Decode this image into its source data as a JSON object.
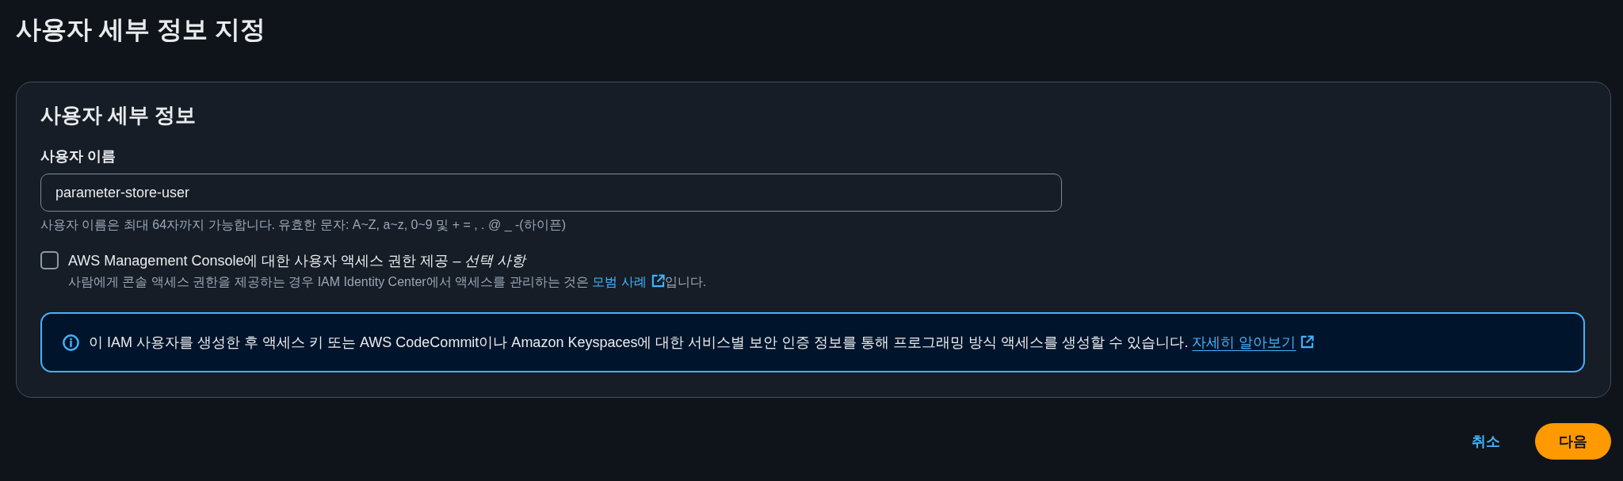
{
  "page": {
    "title": "사용자 세부 정보 지정"
  },
  "card": {
    "title": "사용자 세부 정보",
    "username": {
      "label": "사용자 이름",
      "value": "parameter-store-user",
      "hint": "사용자 이름은 최대 64자까지 가능합니다. 유효한 문자: A~Z, a~z, 0~9 및 + = , . @ _ -(하이픈)"
    },
    "console_access": {
      "checked": false,
      "label": "AWS Management Console에 대한 사용자 액세스 권한 제공 – *선택 사항*",
      "description": "사람에게 콘솔 액세스 권한을 제공하는 경우 IAM Identity Center에서 액세스를 관리하는 것은",
      "link": "모범 사례",
      "description_end": "입니다."
    },
    "info_alert": {
      "message": "이 IAM 사용자를 생성한 후 액세스 키 또는 AWS CodeCommit이나 Amazon Keyspaces에 대한 서비스별 보안 인증 정보를 통해 프로그래밍 방식 액세스를 생성할 수 있습니다.",
      "link": "자세히 알아보기"
    }
  },
  "actions": [
    {
      "kind": "link",
      "label": "취소"
    },
    {
      "kind": "primary",
      "label": "다음"
    }
  ]
}
